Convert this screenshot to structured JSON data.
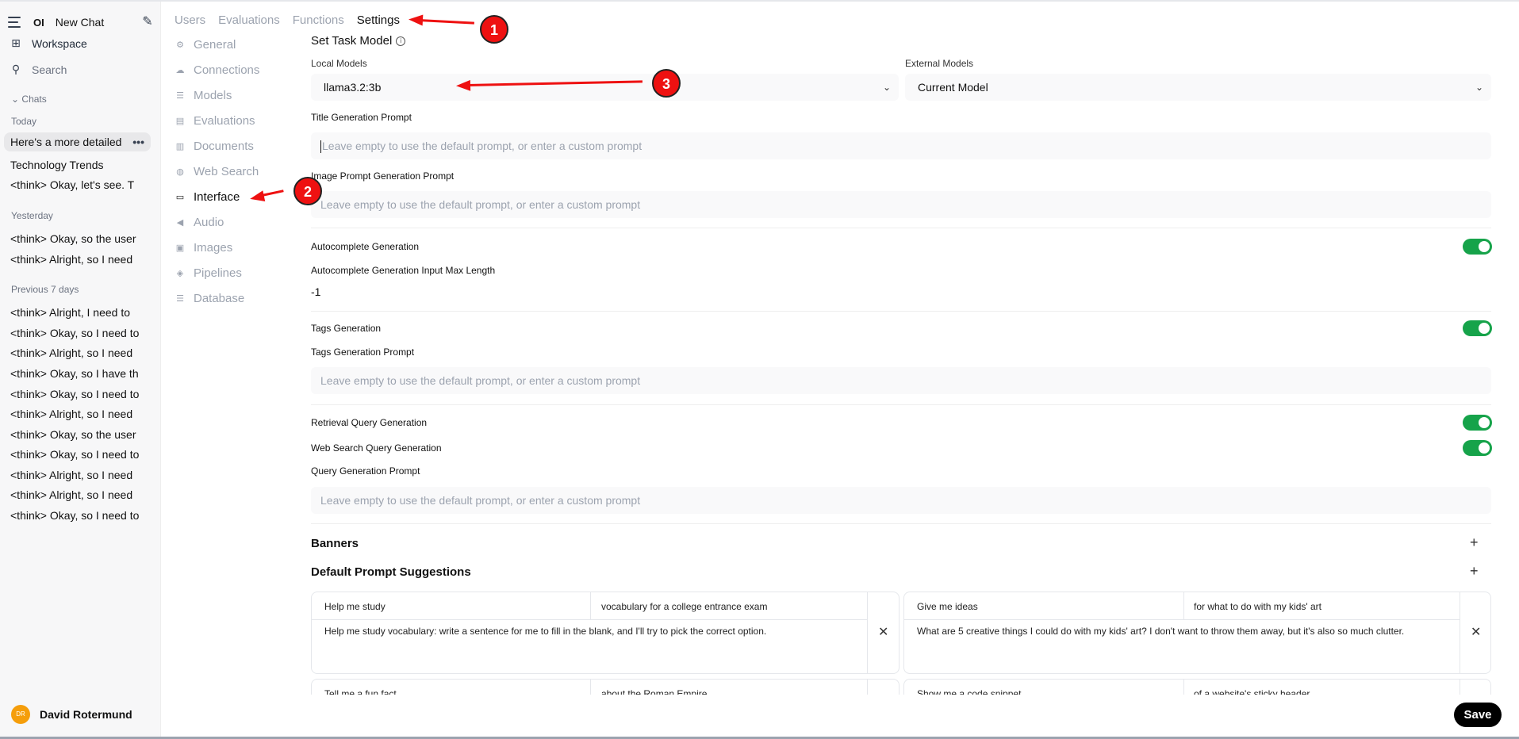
{
  "sidebar": {
    "logo": "OI",
    "new_chat": "New Chat",
    "workspace": "Workspace",
    "search": "Search",
    "chats_label": "Chats",
    "sections": {
      "today": "Today",
      "yesterday": "Yesterday",
      "previous": "Previous 7 days"
    },
    "today_chats": [
      "Here's a more detailed",
      "Technology Trends",
      "<think> Okay, let's see. T"
    ],
    "yesterday_chats": [
      "<think> Okay, so the user",
      "<think> Alright, so I need"
    ],
    "previous_chats": [
      "<think> Alright, I need to",
      "<think> Okay, so I need to",
      "<think> Alright, so I need",
      "<think> Okay, so I have th",
      "<think> Okay, so I need to",
      "<think> Alright, so I need",
      "<think> Okay, so the user",
      "<think> Okay, so I need to",
      "<think> Alright, so I need",
      "<think> Alright, so I need",
      "<think> Okay, so I need to"
    ],
    "user": {
      "initials": "DR",
      "name": "David Rotermund"
    }
  },
  "tabs": [
    "Users",
    "Evaluations",
    "Functions",
    "Settings"
  ],
  "settings_nav": [
    "General",
    "Connections",
    "Models",
    "Evaluations",
    "Documents",
    "Web Search",
    "Interface",
    "Audio",
    "Images",
    "Pipelines",
    "Database"
  ],
  "main": {
    "title": "Set Task Model",
    "local_models_label": "Local Models",
    "local_model_value": "llama3.2:3b",
    "external_models_label": "External Models",
    "external_model_value": "Current Model",
    "title_prompt_label": "Title Generation Prompt",
    "placeholder": "Leave empty to use the default prompt, or enter a custom prompt",
    "image_prompt_label": "Image Prompt Generation Prompt",
    "autocomplete_label": "Autocomplete Generation",
    "autocomplete_max_label": "Autocomplete Generation Input Max Length",
    "autocomplete_max_value": "-1",
    "tags_label": "Tags Generation",
    "tags_prompt_label": "Tags Generation Prompt",
    "retrieval_label": "Retrieval Query Generation",
    "websearch_label": "Web Search Query Generation",
    "query_prompt_label": "Query Generation Prompt",
    "banners": "Banners",
    "default_suggestions": "Default Prompt Suggestions",
    "suggestions": [
      {
        "title": "Help me study",
        "subtitle": "vocabulary for a college entrance exam",
        "content": "Help me study vocabulary: write a sentence for me to fill in the blank, and I'll try to pick the correct option."
      },
      {
        "title": "Give me ideas",
        "subtitle": "for what to do with my kids' art",
        "content": "What are 5 creative things I could do with my kids' art? I don't want to throw them away, but it's also so much clutter."
      },
      {
        "title": "Tell me a fun fact",
        "subtitle": "about the Roman Empire",
        "content": ""
      },
      {
        "title": "Show me a code snippet",
        "subtitle": "of a website's sticky header",
        "content": ""
      }
    ],
    "save": "Save"
  },
  "annotations": [
    "1",
    "2",
    "3"
  ],
  "colors": {
    "accent": "#16a34a",
    "annotation": "#ee1111"
  }
}
